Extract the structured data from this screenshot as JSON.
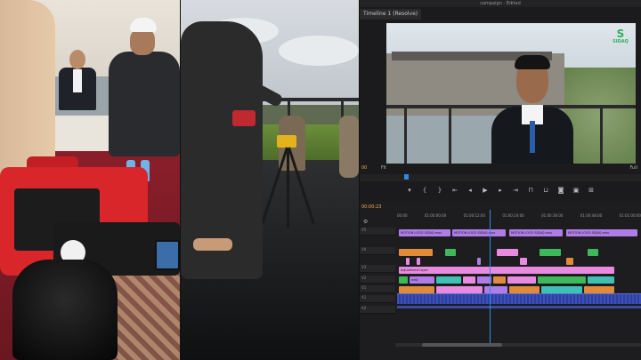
{
  "editor": {
    "project_name": "campaign - Edited",
    "monitor_tab": "Timeline 1 (Resolve)",
    "timecode_left": "00",
    "fit_label": "Fit",
    "full_label": "Full",
    "timeline_timecode": "00:00:23",
    "logo_glyph": "S",
    "logo_text": "SIDAQ",
    "ruler_ticks": [
      "00:00",
      "01:00:00:00",
      "01:00:12:00",
      "01:00:24:00",
      "01:00:36:00",
      "01:00:48:00",
      "01:01:00:00"
    ],
    "tracks": [
      "V5",
      "V4",
      "V3",
      "V2",
      "V1",
      "A1",
      "A2"
    ],
    "transport_icons": [
      "marker-icon",
      "in-point-icon",
      "out-point-icon",
      "go-to-in-icon",
      "step-back-icon",
      "play-icon",
      "step-forward-icon",
      "go-to-out-icon",
      "insert-icon",
      "overwrite-icon",
      "export-frame-icon",
      "compare-icon",
      "settings-icon"
    ],
    "clips": {
      "motion_logo": "MOTION LOGO SIDAQ.mov",
      "adjustment": "Adjustment Layer",
      "nested": "nest",
      "footage": "footage"
    }
  },
  "colors": {
    "timeline_bg": "#1d1d1f",
    "playhead": "#2e8be6",
    "timecode": "#e8b04a",
    "clip_pink": "#e88ae0",
    "clip_purple": "#b07ce8",
    "clip_green": "#3fb85a",
    "clip_orange": "#e08a3a",
    "clip_teal": "#3ec1b4",
    "audio": "#3c4fb8"
  }
}
